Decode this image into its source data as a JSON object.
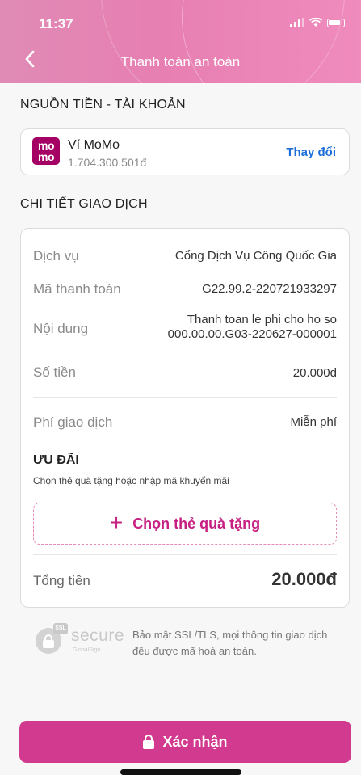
{
  "status_bar": {
    "time": "11:37"
  },
  "header": {
    "title": "Thanh toán an toàn"
  },
  "source": {
    "section_title": "NGUỒN TIỀN - TÀI KHOẢN",
    "logo_text_top": "mo",
    "logo_text_bottom": "mo",
    "wallet_name": "Ví MoMo",
    "balance": "1.704.300.501đ",
    "change_label": "Thay đổi"
  },
  "details": {
    "section_title": "CHI TIẾT GIAO DỊCH",
    "service_label": "Dịch vụ",
    "service_value": "Cổng Dịch Vụ Công Quốc Gia",
    "payment_code_label": "Mã thanh toán",
    "payment_code_value": "G22.99.2-220721933297",
    "content_label": "Nội dung",
    "content_value_line1": "Thanh toan le phi cho ho so",
    "content_value_line2": "000.00.00.G03-220627-000001",
    "amount_label": "Số tiền",
    "amount_value": "20.000đ",
    "fee_label": "Phí giao dịch",
    "fee_value": "Miễn phí",
    "promo_title": "ƯU ĐÃI",
    "promo_subtitle": "Chọn thẻ quà tặng hoặc nhập mã khuyến mãi",
    "gift_button_label": "Chọn thẻ quà tặng",
    "total_label": "Tổng tiền",
    "total_value": "20.000đ"
  },
  "security": {
    "ssl_tag": "SSL",
    "secure_word": "secure",
    "globalsign": "GlobalSign",
    "text": "Bảo mật SSL/TLS, mọi thông tin giao dịch đều được mã hoá an toàn."
  },
  "footer": {
    "confirm_label": "Xác nhận"
  },
  "colors": {
    "brand": "#d13a8e",
    "link": "#1e6fd9",
    "momo": "#a50064"
  }
}
